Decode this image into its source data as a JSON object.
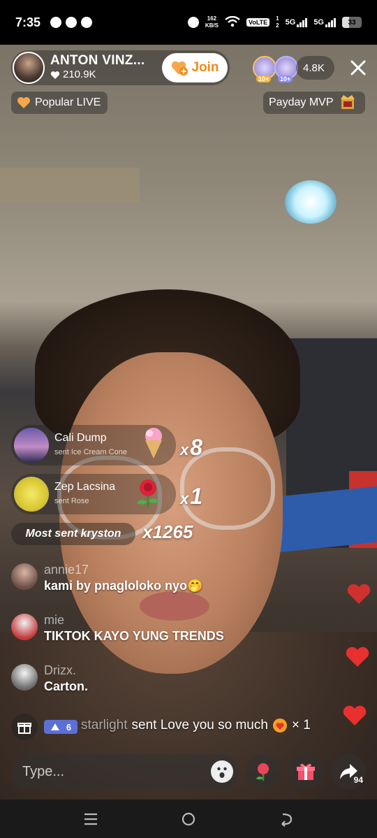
{
  "status_bar": {
    "time": "7:35",
    "net_speed_top": "162",
    "net_speed_bottom": "KB/S",
    "volte": "VoLTE",
    "sim_top": "1",
    "sim_bottom": "2",
    "net1": "5G",
    "net2": "5G",
    "battery": "33"
  },
  "host": {
    "name": "ANTON VINZ...",
    "likes": "210.9K",
    "join_label": "Join"
  },
  "viewers": {
    "badge1": "10+",
    "badge2": "10+",
    "count": "4.8K"
  },
  "tags": {
    "popular": "Popular LIVE",
    "payday": "Payday MVP"
  },
  "gifts": [
    {
      "user": "Cali Dump",
      "action": "sent Ice Cream Cone",
      "icon": "ice-cream-icon",
      "mult_prefix": "x",
      "mult": "8"
    },
    {
      "user": "Zep Lacsina",
      "action": "sent Rose",
      "icon": "rose-icon",
      "mult_prefix": "x",
      "mult": "1"
    }
  ],
  "most_sent": {
    "label": "Most sent kryston",
    "count": "x1265"
  },
  "comments": [
    {
      "user": "annie17",
      "text": "kami by pnagloloko nyo🤭"
    },
    {
      "user": "mie",
      "text": "TIKTOK KAYO YUNG TRENDS"
    },
    {
      "user": "Drizx.",
      "text": "Carton."
    }
  ],
  "gift_line": {
    "level": "6",
    "user": "starlight",
    "text": "sent Love you so much",
    "mult": "× 1"
  },
  "input": {
    "placeholder": "Type..."
  },
  "share_count": "94",
  "colors": {
    "accent_orange": "#f08a1c",
    "heart_red": "#e8302f",
    "level_badge": "#5b6fd6"
  }
}
